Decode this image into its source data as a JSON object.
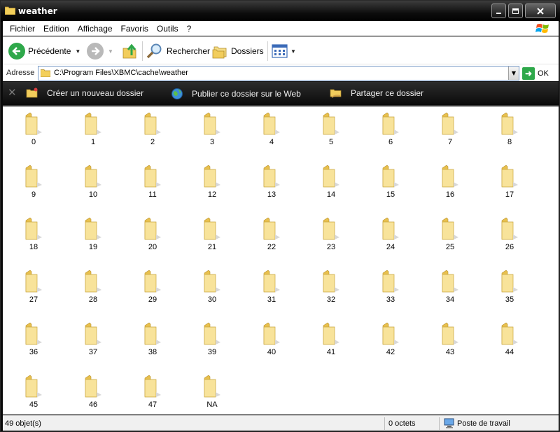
{
  "window": {
    "title": "weather",
    "minimize_icon": "minimize-icon",
    "maximize_icon": "maximize-icon",
    "close_icon": "close-icon"
  },
  "menu": [
    "Fichier",
    "Edition",
    "Affichage",
    "Favoris",
    "Outils",
    "?"
  ],
  "toolbar": {
    "back_label": "Précédente",
    "search_label": "Rechercher",
    "folders_label": "Dossiers"
  },
  "address": {
    "label": "Adresse",
    "value": "C:\\Program Files\\XBMC\\cache\\weather",
    "go_label": "OK"
  },
  "tasks": {
    "new_folder": "Créer un nouveau dossier",
    "publish": "Publier ce dossier sur le Web",
    "share": "Partager ce dossier"
  },
  "folders": [
    "0",
    "1",
    "2",
    "3",
    "4",
    "5",
    "6",
    "7",
    "8",
    "9",
    "10",
    "11",
    "12",
    "13",
    "14",
    "15",
    "16",
    "17",
    "18",
    "19",
    "20",
    "21",
    "22",
    "23",
    "24",
    "25",
    "26",
    "27",
    "28",
    "29",
    "30",
    "31",
    "32",
    "33",
    "34",
    "35",
    "36",
    "37",
    "38",
    "39",
    "40",
    "41",
    "42",
    "43",
    "44",
    "45",
    "46",
    "47",
    "NA"
  ],
  "status": {
    "count": "49 objet(s)",
    "size": "0 octets",
    "location": "Poste de travail"
  },
  "colors": {
    "accent_green": "#2ea84a",
    "folder_yellow": "#f5dc84",
    "title_bar": "#000000"
  }
}
